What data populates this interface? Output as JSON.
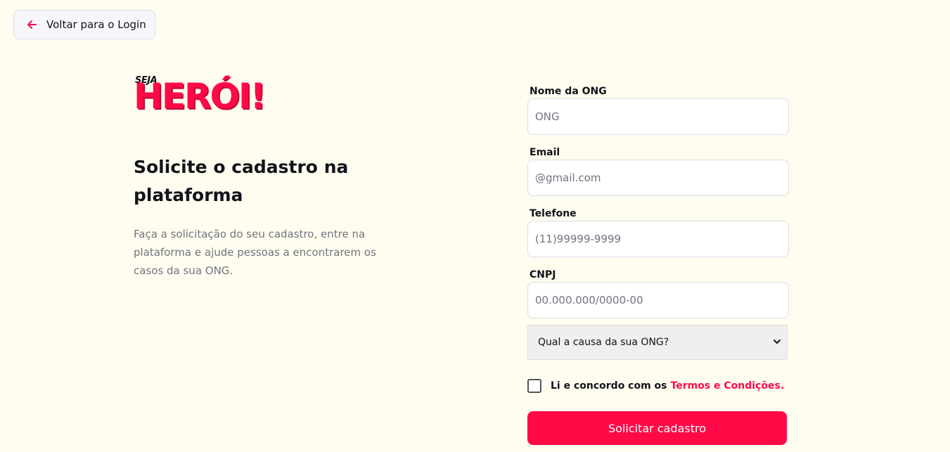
{
  "back_button": {
    "label": "Voltar para o Login",
    "icon": "arrow-left-icon"
  },
  "logo": {
    "seja": "SEJA",
    "heroi": "HERÓI!"
  },
  "headline": "Solicite o cadastro na plataforma",
  "description": "Faça a solicitação do seu cadastro, entre na plataforma e ajude pessoas a encontrarem os casos da sua ONG.",
  "form": {
    "name": {
      "label": "Nome da ONG",
      "placeholder": "ONG",
      "value": ""
    },
    "email": {
      "label": "Email",
      "placeholder": "@gmail.com",
      "value": ""
    },
    "phone": {
      "label": "Telefone",
      "placeholder": "(11)99999-9999",
      "value": ""
    },
    "cnpj": {
      "label": "CNPJ",
      "placeholder": "00.000.000/0000-00",
      "value": ""
    },
    "cause_select": {
      "selected": "Qual a causa da sua ONG?"
    },
    "terms": {
      "text": "Li e concordo com os",
      "link": "Termos e Condições."
    },
    "submit_label": "Solicitar cadastro"
  },
  "colors": {
    "background": "#fffdef",
    "accent": "#ff0a47",
    "text": "#13131a",
    "muted": "#737380"
  }
}
